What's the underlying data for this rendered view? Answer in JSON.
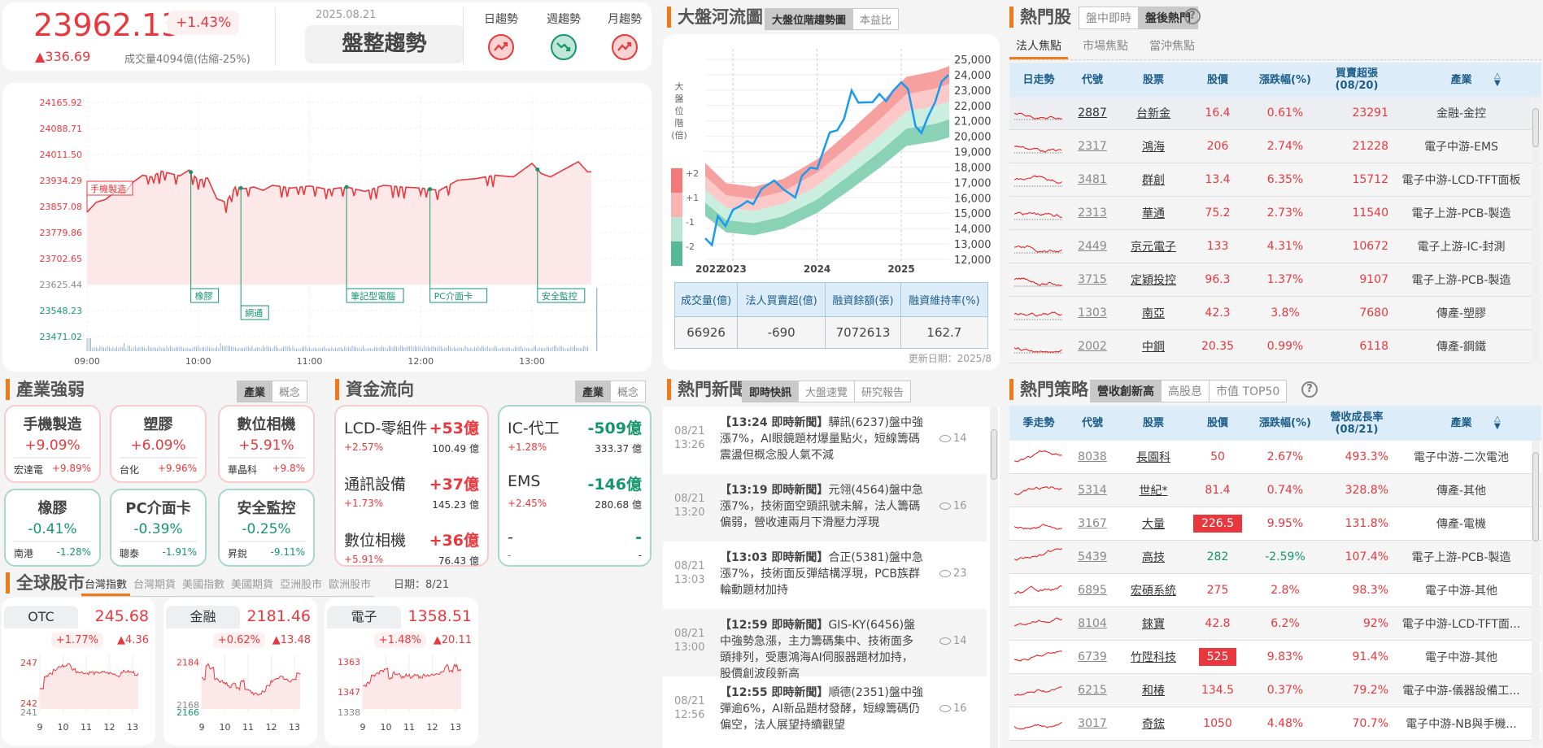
{
  "header": {
    "index_value": "23962.13",
    "change_pct": "+1.43%",
    "change": "▲336.69",
    "volume": "成交量4094億(估縮-25%)",
    "date": "2025.08.21",
    "trend_label": "盤整趨勢",
    "trends": [
      {
        "label": "日趨勢",
        "dir": "up"
      },
      {
        "label": "週趨勢",
        "dir": "down"
      },
      {
        "label": "月趨勢",
        "dir": "up"
      }
    ]
  },
  "intraday": {
    "yticks": [
      {
        "label": "24165.92",
        "value": 24165.92,
        "state": "up"
      },
      {
        "label": "24088.71",
        "value": 24088.71,
        "state": "up"
      },
      {
        "label": "24011.50",
        "value": 24011.5,
        "state": "up"
      },
      {
        "label": "23934.29",
        "value": 23934.29,
        "state": "up"
      },
      {
        "label": "23857.08",
        "value": 23857.08,
        "state": "up"
      },
      {
        "label": "23779.86",
        "value": 23779.86,
        "state": "up"
      },
      {
        "label": "23702.65",
        "value": 23702.65,
        "state": "up"
      },
      {
        "label": "23625.44",
        "value": 23625.44,
        "state": "flat"
      },
      {
        "label": "23548.23",
        "value": 23548.23,
        "state": "down"
      },
      {
        "label": "23471.02",
        "value": 23471.02,
        "state": "down"
      }
    ],
    "xticks": [
      "09:00",
      "10:00",
      "11:00",
      "12:00",
      "13:00"
    ],
    "series_minutes": [
      0,
      5,
      10,
      15,
      20,
      25,
      30,
      35,
      40,
      45,
      50,
      55,
      60,
      65,
      70,
      75,
      80,
      85,
      90,
      95,
      100,
      110,
      120,
      130,
      140,
      150,
      160,
      170,
      180,
      190,
      200,
      210,
      220,
      230,
      240,
      245,
      250,
      255,
      260,
      265,
      270
    ],
    "series_values": [
      23840,
      23870,
      23878,
      23900,
      23895,
      23930,
      23950,
      23945,
      23962,
      23955,
      23948,
      23965,
      23935,
      23942,
      23880,
      23870,
      23915,
      23910,
      23915,
      23905,
      23920,
      23912,
      23918,
      23908,
      23915,
      23902,
      23920,
      23915,
      23912,
      23905,
      23935,
      23940,
      23950,
      23945,
      23985,
      23955,
      23945,
      23960,
      23975,
      23990,
      23960
    ],
    "annotations": [
      {
        "label": "手機製造",
        "minute": 0,
        "type": "up"
      },
      {
        "label": "橡膠",
        "minute": 56,
        "type": "down"
      },
      {
        "label": "網通",
        "minute": 83,
        "type": "down",
        "low": true
      },
      {
        "label": "筆記型電腦",
        "minute": 140,
        "type": "down"
      },
      {
        "label": "PC介面卡",
        "minute": 185,
        "type": "down"
      },
      {
        "label": "安全監控",
        "minute": 243,
        "type": "down"
      }
    ]
  },
  "industry": {
    "title": "產業強弱",
    "toggle": [
      "產業",
      "概念"
    ],
    "cards": [
      {
        "name": "手機製造",
        "pct": "+9.09%",
        "stock": "宏達電",
        "stock_pct": "+9.89%",
        "dir": "up"
      },
      {
        "name": "塑膠",
        "pct": "+6.09%",
        "stock": "台化",
        "stock_pct": "+9.96%",
        "dir": "up"
      },
      {
        "name": "數位相機",
        "pct": "+5.91%",
        "stock": "華晶科",
        "stock_pct": "+9.8%",
        "dir": "up"
      },
      {
        "name": "橡膠",
        "pct": "-0.41%",
        "stock": "南港",
        "stock_pct": "-1.28%",
        "dir": "down"
      },
      {
        "name": "PC介面卡",
        "pct": "-0.39%",
        "stock": "聰泰",
        "stock_pct": "-1.91%",
        "dir": "down"
      },
      {
        "name": "安全監控",
        "pct": "-0.25%",
        "stock": "昇銳",
        "stock_pct": "-9.11%",
        "dir": "down"
      }
    ]
  },
  "fund_flow": {
    "title": "資金流向",
    "toggle": [
      "產業",
      "概念"
    ],
    "inflow": [
      {
        "name": "LCD-零組件",
        "amount": "+53億",
        "pct": "+2.57%",
        "volume": "100.49 億"
      },
      {
        "name": "通訊設備",
        "amount": "+37億",
        "pct": "+1.73%",
        "volume": "145.23 億"
      },
      {
        "name": "數位相機",
        "amount": "+36億",
        "pct": "+5.91%",
        "volume": "76.43 億"
      }
    ],
    "outflow": [
      {
        "name": "IC-代工",
        "amount": "-509億",
        "pct": "+1.28%",
        "volume": "333.37 億"
      },
      {
        "name": "EMS",
        "amount": "-146億",
        "pct": "+2.45%",
        "volume": "280.68 億"
      },
      {
        "name": "-",
        "amount": "-",
        "pct": "-",
        "volume": "-"
      }
    ]
  },
  "global": {
    "title": "全球股市",
    "tabs": [
      "台灣指數",
      "台灣期貨",
      "美國指數",
      "美國期貨",
      "亞洲股市",
      "歐洲股市"
    ],
    "date": "日期：8/21",
    "cards": [
      {
        "name": "OTC",
        "value": "245.68",
        "pct": "+1.77%",
        "change": "▲4.36",
        "yticks": [
          {
            "label": "247",
            "v": 247,
            "c": "up"
          },
          {
            "label": "242",
            "v": 242,
            "c": "up"
          },
          {
            "label": "241",
            "v": 241.3,
            "c": "flat"
          }
        ],
        "ymin": 241.3,
        "ymax": 247.2,
        "values": [
          243.9,
          245.3,
          245.6,
          246.1,
          246.5,
          246.6,
          246.8,
          246.2,
          245.9,
          245.8,
          245.7,
          245.8,
          245.7,
          245.8,
          245.8,
          245.7,
          245.6,
          245.4,
          245.9,
          245.9,
          245.8,
          245.6
        ]
      },
      {
        "name": "金融",
        "value": "2181.46",
        "pct": "+0.62%",
        "change": "▲13.48",
        "yticks": [
          {
            "label": "2184",
            "v": 2184,
            "c": "up"
          },
          {
            "label": "2168",
            "v": 2168,
            "c": "flat"
          },
          {
            "label": "2166",
            "v": 2166.5,
            "c": "down"
          }
        ],
        "ymin": 2166.5,
        "ymax": 2184.5,
        "values": [
          2178,
          2183,
          2182,
          2178,
          2177,
          2176,
          2175,
          2176,
          2174,
          2177,
          2174,
          2173,
          2172,
          2172,
          2173,
          2175,
          2177,
          2178,
          2179,
          2178,
          2177,
          2178,
          2180
        ]
      },
      {
        "name": "電子",
        "value": "1358.51",
        "pct": "+1.48%",
        "change": "▲20.11",
        "yticks": [
          {
            "label": "1363",
            "v": 1363,
            "c": "up"
          },
          {
            "label": "1347",
            "v": 1347,
            "c": "up"
          },
          {
            "label": "1338",
            "v": 1338,
            "c": "flat"
          }
        ],
        "ymin": 1338,
        "ymax": 1363.5,
        "values": [
          1350,
          1352,
          1356,
          1357,
          1358,
          1359,
          1354,
          1357,
          1356,
          1355,
          1356,
          1355,
          1356,
          1355,
          1356,
          1356,
          1356,
          1357,
          1358,
          1361,
          1358,
          1361,
          1359
        ]
      }
    ],
    "xticks": [
      "9",
      "10",
      "11",
      "12",
      "13"
    ]
  },
  "river": {
    "title": "大盤河流圖",
    "tabs": [
      "大盤位階趨勢圖",
      "本益比"
    ],
    "legend_title": [
      "大",
      "盤",
      "位",
      "階",
      "(倍)"
    ],
    "legend_labels": [
      "+2",
      "+1",
      "-1",
      "-2"
    ],
    "colors": [
      "#f47a7a",
      "#fab3b3",
      "#b9e6d4",
      "#55b996"
    ],
    "band_colors": [
      "#f7a0a0",
      "#fcc9c9",
      "#caefe1",
      "#89d2b6"
    ],
    "yticks": [
      "25,000",
      "24,000",
      "23,000",
      "22,000",
      "21,000",
      "20,000",
      "19,000",
      "18,000",
      "17,000",
      "16,000",
      "15,000",
      "14,000",
      "13,000",
      "12,000"
    ],
    "xticks": [
      {
        "label": "2022",
        "year": 2022.67
      },
      {
        "label": "2023",
        "year": 2023
      },
      {
        "label": "2024",
        "year": 2024
      },
      {
        "label": "2025",
        "year": 2025
      }
    ],
    "year_range": [
      2022.67,
      2025.57
    ],
    "value_range": [
      12000,
      25000
    ],
    "band_step": 0.052,
    "mid_years": [
      2022.67,
      2022.92,
      2023.25,
      2023.6,
      2024.0,
      2024.37,
      2024.76,
      2025.06,
      2025.41,
      2025.57
    ],
    "mid_values": [
      16540,
      15350,
      15140,
      15610,
      16760,
      18350,
      20110,
      21610,
      21960,
      22250
    ],
    "index_years": [
      2022.67,
      2022.75,
      2022.82,
      2022.91,
      2023.0,
      2023.09,
      2023.17,
      2023.24,
      2023.34,
      2023.49,
      2023.6,
      2023.74,
      2023.82,
      2023.92,
      2024.0,
      2024.15,
      2024.24,
      2024.32,
      2024.41,
      2024.49,
      2024.66,
      2024.74,
      2024.82,
      2024.9,
      2025.0,
      2025.08,
      2025.17,
      2025.24,
      2025.32,
      2025.4,
      2025.48,
      2025.56
    ],
    "index_values": [
      13370,
      12930,
      14810,
      14170,
      15220,
      15480,
      15780,
      15580,
      16580,
      17130,
      16550,
      16020,
      17430,
      17960,
      17890,
      20250,
      20390,
      21130,
      22980,
      22190,
      22220,
      22750,
      22270,
      22930,
      23510,
      23070,
      20640,
      20210,
      21300,
      22190,
      23560,
      23980
    ],
    "stats_headers": [
      "成交量(億)",
      "法人買賣超(億)",
      "融資餘額(張)",
      "融資維持率(%)"
    ],
    "stats_values": [
      "66926",
      "-690",
      "7072613",
      "162.7"
    ],
    "update": "更新日期：2025/8"
  },
  "news": {
    "title": "熱門新聞",
    "tabs": [
      "即時快訊",
      "大盤速覽",
      "研究報告"
    ],
    "items": [
      {
        "date": "08/21",
        "time": "13:26",
        "head": "【13:24 即時新聞】",
        "text": "驊訊(6237)盤中強漲7%，AI眼鏡題材爆量點火，短線籌碼震盪但概念股人氣不減",
        "views": "14"
      },
      {
        "date": "08/21",
        "time": "13:20",
        "head": "【13:19 即時新聞】",
        "text": "元翎(4564)盤中急漲7%，技術面空頭訊號未解，法人籌碼偏弱，營收連兩月下滑壓力浮現",
        "views": "16"
      },
      {
        "date": "08/21",
        "time": "13:03",
        "head": "【13:03 即時新聞】",
        "text": "合正(5381)盤中急漲7%，技術面反彈結構浮現，PCB族群輪動題材加持",
        "views": "23"
      },
      {
        "date": "08/21",
        "time": "13:00",
        "head": "【12:59 即時新聞】",
        "text": "GIS-KY(6456)盤中強勢急漲，主力籌碼集中、技術面多頭排列，受惠鴻海AI伺服器題材加持，股價創波段新高",
        "views": "14"
      },
      {
        "date": "08/21",
        "time": "12:56",
        "head": "【12:55 即時新聞】",
        "text": "順德(2351)盤中強彈逾6%，AI新品題材發酵，短線籌碼仍偏空，法人展望持續觀望",
        "views": "16"
      }
    ]
  },
  "hot": {
    "title": "熱門股",
    "toggle": [
      "盤中即時",
      "盤後熱門"
    ],
    "help": "?",
    "subtabs": [
      "法人焦點",
      "市場焦點",
      "當沖焦點"
    ],
    "columns": [
      "日走勢",
      "代號",
      "股票",
      "股價",
      "漲跌幅(%)",
      "買賣超張\n(08/20)",
      "產業"
    ],
    "rows": [
      {
        "code": "2887",
        "name": "台新金",
        "price": "16.4",
        "pct": "0.61%",
        "metric": "23291",
        "industry": "金融-金控",
        "dir": "up"
      },
      {
        "code": "2317",
        "name": "鴻海",
        "price": "206",
        "pct": "2.74%",
        "metric": "21228",
        "industry": "電子中游-EMS",
        "dir": "up"
      },
      {
        "code": "3481",
        "name": "群創",
        "price": "13.4",
        "pct": "6.35%",
        "metric": "15712",
        "industry": "電子中游-LCD-TFT面板",
        "dir": "up"
      },
      {
        "code": "2313",
        "name": "華通",
        "price": "75.2",
        "pct": "2.73%",
        "metric": "11540",
        "industry": "電子上游-PCB-製造",
        "dir": "up"
      },
      {
        "code": "2449",
        "name": "京元電子",
        "price": "133",
        "pct": "4.31%",
        "metric": "10672",
        "industry": "電子上游-IC-封測",
        "dir": "up"
      },
      {
        "code": "3715",
        "name": "定穎投控",
        "price": "96.3",
        "pct": "1.37%",
        "metric": "9107",
        "industry": "電子上游-PCB-製造",
        "dir": "up"
      },
      {
        "code": "1303",
        "name": "南亞",
        "price": "42.3",
        "pct": "3.8%",
        "metric": "7680",
        "industry": "傳產-塑膠",
        "dir": "up"
      },
      {
        "code": "2002",
        "name": "中鋼",
        "price": "20.35",
        "pct": "0.99%",
        "metric": "6118",
        "industry": "傳產-鋼鐵",
        "dir": "up"
      }
    ]
  },
  "strategy": {
    "title": "熱門策略",
    "toggle": [
      "營收創新高",
      "高股息",
      "市值 TOP50"
    ],
    "help": "?",
    "columns": [
      "季走勢",
      "代號",
      "股票",
      "股價",
      "漲跌幅(%)",
      "營收成長率\n(08/21)",
      "產業"
    ],
    "rows": [
      {
        "code": "8038",
        "name": "長園科",
        "price": "50",
        "pct": "2.67%",
        "metric": "493.3%",
        "industry": "電子中游-二次電池",
        "dir": "up"
      },
      {
        "code": "5314",
        "name": "世紀*",
        "price": "81.4",
        "pct": "0.74%",
        "metric": "328.8%",
        "industry": "傳產-其他",
        "dir": "up"
      },
      {
        "code": "3167",
        "name": "大量",
        "price": "226.5",
        "pct": "9.95%",
        "metric": "131.8%",
        "industry": "傳產-電機",
        "dir": "up",
        "limit": true
      },
      {
        "code": "5439",
        "name": "高技",
        "price": "282",
        "pct": "-2.59%",
        "metric": "107.4%",
        "industry": "電子上游-PCB-製造",
        "dir": "down"
      },
      {
        "code": "6895",
        "name": "宏碩系統",
        "price": "275",
        "pct": "2.8%",
        "metric": "98.3%",
        "industry": "電子中游-其他",
        "dir": "up"
      },
      {
        "code": "8104",
        "name": "錸寶",
        "price": "42.8",
        "pct": "6.2%",
        "metric": "92%",
        "industry": "電子中游-LCD-TFT面...",
        "dir": "up"
      },
      {
        "code": "6739",
        "name": "竹陞科技",
        "price": "525",
        "pct": "9.83%",
        "metric": "91.4%",
        "industry": "電子中游-其他",
        "dir": "up",
        "limit": true
      },
      {
        "code": "6215",
        "name": "和椿",
        "price": "134.5",
        "pct": "0.37%",
        "metric": "79.2%",
        "industry": "電子中游-儀器設備工...",
        "dir": "up"
      },
      {
        "code": "3017",
        "name": "奇鋐",
        "price": "1050",
        "pct": "4.48%",
        "metric": "70.7%",
        "industry": "電子中游-NB與手機...",
        "dir": "up"
      }
    ]
  },
  "colors": {
    "up": "#e8383d",
    "down": "#16976a",
    "flat": "#888888",
    "accent": "#f07a1a",
    "index_line": "#1a9bf0"
  }
}
